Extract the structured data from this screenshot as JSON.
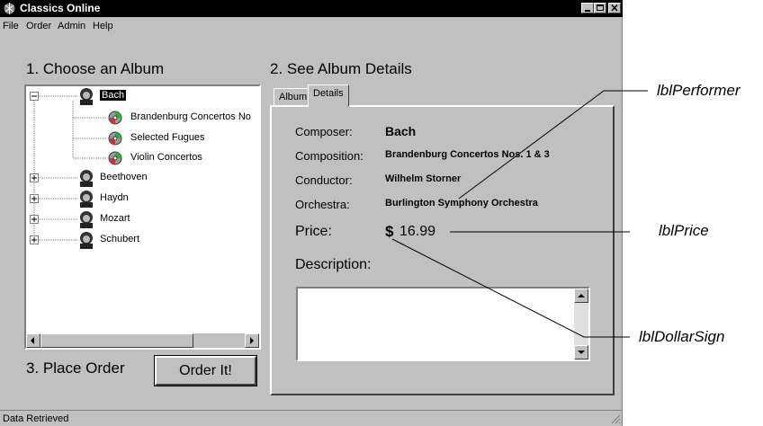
{
  "window": {
    "title": "Classics Online"
  },
  "menu": [
    "File",
    "Order",
    "Admin",
    "Help"
  ],
  "sections": {
    "choose": "1. Choose an Album",
    "details": "2. See Album Details",
    "order": "3. Place Order"
  },
  "tree": {
    "composers": [
      "Bach",
      "Beethoven",
      "Haydn",
      "Mozart",
      "Schubert"
    ],
    "bach_albums": [
      "Brandenburg Concertos No",
      "Selected Fugues",
      "Violin Concertos"
    ]
  },
  "tabs": [
    "Album",
    "Details"
  ],
  "details": {
    "composer_label": "Composer:",
    "composer_value": "Bach",
    "composition_label": "Composition:",
    "composition_value": "Brandenburg Concertos Nos. 1 & 3",
    "conductor_label": "Conductor:",
    "conductor_value": "Wilhelm Storner",
    "orchestra_label": "Orchestra:",
    "orchestra_value": "Burlington Symphony Orchestra",
    "price_label": "Price:",
    "dollar_sign": "$",
    "price_value": "16.99",
    "description_label": "Description:"
  },
  "order_button": "Order It!",
  "status": "Data Retrieved",
  "callouts": {
    "performer": "lblPerformer",
    "price": "lblPrice",
    "dollar": "lblDollarSign"
  },
  "colors": {
    "face": "#c0c0c0",
    "titlebar": "#000000"
  }
}
